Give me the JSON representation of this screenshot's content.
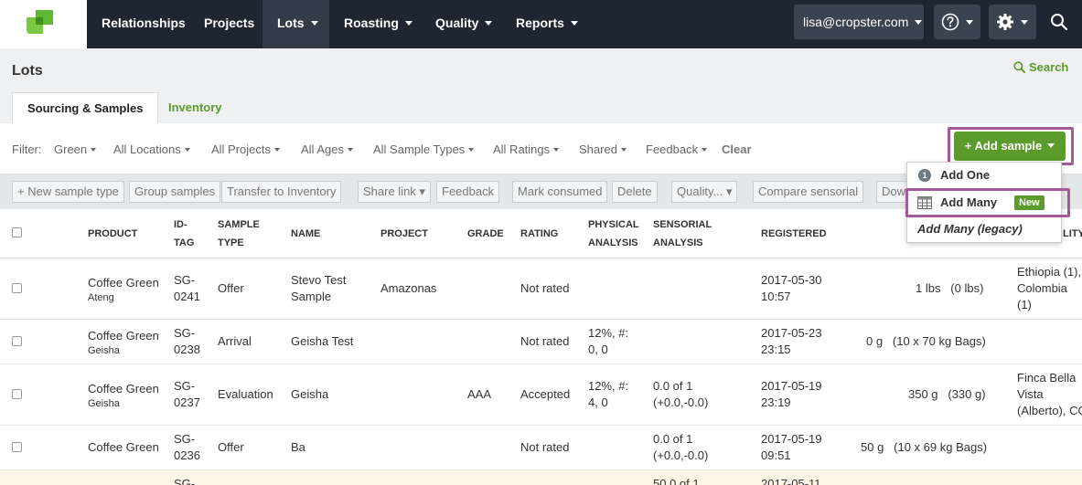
{
  "nav": {
    "items": [
      "Relationships",
      "Projects",
      "Lots",
      "Roasting",
      "Quality",
      "Reports"
    ],
    "user": "lisa@cropster.com",
    "help_icon": "help-circle-icon",
    "settings_icon": "gear-icon",
    "search_icon": "search-icon",
    "bg_color": "#1d2631",
    "active_color": "#323c48"
  },
  "header": {
    "title": "Lots",
    "search_label": "Search",
    "tabs": [
      "Sourcing & Samples",
      "Inventory"
    ]
  },
  "filters": {
    "label": "Filter:",
    "items": [
      "Green",
      "All Locations",
      "All Projects",
      "All Ages",
      "All Sample Types",
      "All Ratings",
      "Shared",
      "Feedback"
    ],
    "clear": "Clear"
  },
  "add_sample": {
    "label": "+ Add sample",
    "color": "#5a9b2c",
    "menu": {
      "add_one": "Add One",
      "add_one_badge": "1",
      "add_many": "Add Many",
      "add_many_badge": "New",
      "add_many_legacy": "Add Many (legacy)"
    }
  },
  "actions": [
    "+ New sample type",
    "Group samples",
    "Transfer to Inventory",
    "Share link ▾",
    "Feedback",
    "Mark consumed",
    "Delete",
    "Quality... ▾",
    "Compare sensorial",
    "Dow"
  ],
  "table": {
    "headers": {
      "product": "PRODUCT",
      "idtag1": "ID-",
      "idtag2": "TAG",
      "type1": "SAMPLE",
      "type2": "TYPE",
      "name": "NAME",
      "project": "PROJECT",
      "grade": "GRADE",
      "rating": "RATING",
      "phys1": "PHYSICAL",
      "phys2": "ANALYSIS",
      "sens1": "SENSORIAL",
      "sens2": "ANALYSIS",
      "registered": "REGISTERED",
      "partial_s": "S",
      "partial_lity": "LITY"
    },
    "rows": [
      {
        "product": "Coffee Green",
        "sub": "Ateng",
        "id1": "SG-",
        "id2": "0241",
        "type": "Offer",
        "name1": "Stevo Test",
        "name2": "Sample",
        "project": "Amazonas",
        "grade": "",
        "rating": "Not rated",
        "phys1": "",
        "phys2": "",
        "sens1": "",
        "sens2": "",
        "reg1": "2017-05-30",
        "reg2": "10:57",
        "weight": "1 lbs   (0 lbs)",
        "origin1": "Ethiopia (1),",
        "origin2": "Colombia",
        "origin3": "(1)"
      },
      {
        "product": "Coffee Green",
        "sub": "Geisha",
        "id1": "SG-",
        "id2": "0238",
        "type": "Arrival",
        "name1": "Geisha Test",
        "name2": "",
        "project": "",
        "grade": "",
        "rating": "Not rated",
        "phys1": "12%, #:",
        "phys2": "0, 0",
        "sens1": "",
        "sens2": "",
        "reg1": "2017-05-23",
        "reg2": "23:15",
        "weight": "0 g   (10 x 70 kg Bags)",
        "origin1": "",
        "origin2": "",
        "origin3": ""
      },
      {
        "product": "Coffee Green",
        "sub": "Geisha",
        "id1": "SG-",
        "id2": "0237",
        "type": "Evaluation",
        "name1": "Geisha",
        "name2": "",
        "project": "",
        "grade": "AAA",
        "rating": "Accepted",
        "phys1": "12%, #:",
        "phys2": "4, 0",
        "sens1": "0.0 of 1",
        "sens2": "(+0.0,-0.0)",
        "reg1": "2017-05-19",
        "reg2": "23:19",
        "weight": "350 g   (330 g)",
        "origin1": "Finca Bella",
        "origin2": "Vista",
        "origin3": "(Alberto), CO"
      },
      {
        "product": "Coffee Green",
        "sub": "",
        "id1": "SG-",
        "id2": "0236",
        "type": "Offer",
        "name1": "Ba",
        "name2": "",
        "project": "",
        "grade": "",
        "rating": "Not rated",
        "phys1": "",
        "phys2": "",
        "sens1": "0.0 of 1",
        "sens2": "(+0.0,-0.0)",
        "reg1": "2017-05-19",
        "reg2": "09:51",
        "weight": "50 g   (10 x 69 kg Bags)",
        "origin1": "",
        "origin2": "",
        "origin3": ""
      }
    ],
    "partial_row": {
      "id1": "SG-",
      "sens1": "50.0 of 1",
      "reg1": "2017-05-11"
    }
  }
}
